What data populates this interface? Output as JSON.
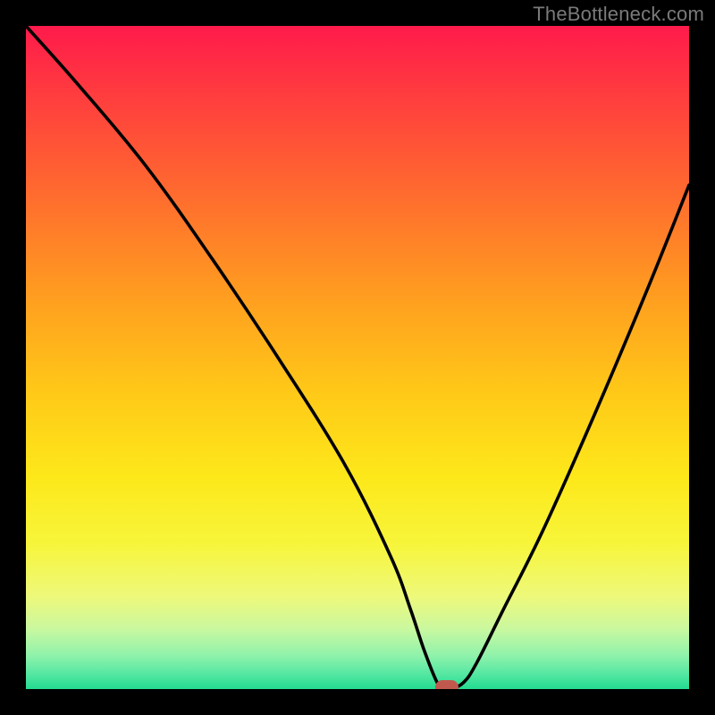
{
  "attribution": "TheBottleneck.com",
  "chart_data": {
    "type": "line",
    "title": "",
    "xlabel": "",
    "ylabel": "",
    "xlim": [
      0,
      100
    ],
    "ylim": [
      0,
      100
    ],
    "series": [
      {
        "name": "bottleneck-curve",
        "x": [
          0,
          8,
          18,
          28,
          38,
          48,
          55,
          58,
          60,
          62,
          63,
          64,
          66,
          68,
          72,
          78,
          86,
          94,
          100
        ],
        "values": [
          100,
          91,
          79,
          65,
          50,
          34,
          20,
          12,
          6,
          1,
          0,
          0,
          1,
          4,
          12,
          24,
          42,
          61,
          76
        ]
      }
    ],
    "marker": {
      "x": 63.5,
      "y": 0
    },
    "background_gradient": {
      "stops": [
        {
          "pos": 0.0,
          "color": "#ff1a4b"
        },
        {
          "pos": 0.25,
          "color": "#ff6a2f"
        },
        {
          "pos": 0.55,
          "color": "#ffc818"
        },
        {
          "pos": 0.78,
          "color": "#f7f53a"
        },
        {
          "pos": 0.95,
          "color": "#8ef2ab"
        },
        {
          "pos": 1.0,
          "color": "#23db90"
        }
      ]
    }
  }
}
